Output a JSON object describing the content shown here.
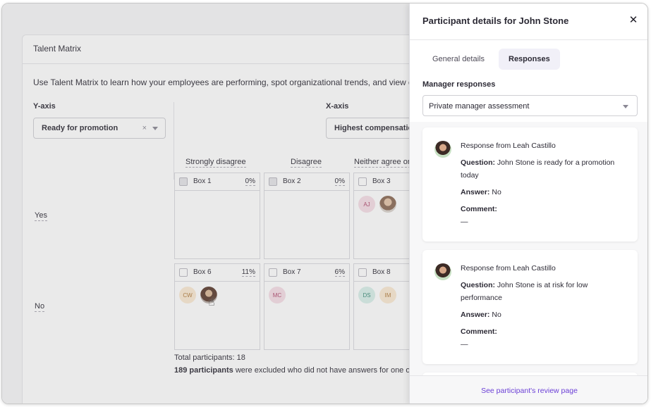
{
  "background": {
    "card_title": "Talent Matrix",
    "intro": "Use Talent Matrix to learn how your employees are performing, spot organizational trends, and view detailed",
    "y_axis": {
      "label": "Y-axis",
      "value": "Ready for promotion",
      "clear": "×"
    },
    "x_axis": {
      "label": "X-axis",
      "value": "Highest compensatio"
    },
    "columns": [
      "Strongly disagree",
      "Disagree",
      "Neither agree or"
    ],
    "rows": [
      "Yes",
      "No"
    ],
    "boxes": [
      {
        "name": "Box 1",
        "pct": "0%"
      },
      {
        "name": "Box 2",
        "pct": "0%"
      },
      {
        "name": "Box 3",
        "pct": "",
        "avatars": [
          "AJ"
        ]
      },
      {
        "name": "Box 6",
        "pct": "11%",
        "avatars": [
          "CW"
        ]
      },
      {
        "name": "Box 7",
        "pct": "6%",
        "avatars": [
          "MC"
        ]
      },
      {
        "name": "Box 8",
        "pct": "",
        "avatars": [
          "DS",
          "IM"
        ]
      }
    ],
    "totals_line1": "Total participants: 18",
    "totals_line2_bold": "189 participants",
    "totals_line2_rest": " were excluded who did not have answers for one or"
  },
  "drawer": {
    "title": "Participant details for John Stone",
    "close": "✕",
    "tabs": [
      {
        "label": "General details",
        "active": false
      },
      {
        "label": "Responses",
        "active": true
      }
    ],
    "manager_label": "Manager responses",
    "manager_select": "Private manager assessment",
    "responses": [
      {
        "from": "Response from Leah Castillo",
        "question_label": "Question:",
        "question": " John Stone is ready for a promotion today",
        "answer_label": "Answer:",
        "answer": " No",
        "comment_label": "Comment:",
        "comment": "—"
      },
      {
        "from": "Response from Leah Castillo",
        "question_label": "Question:",
        "question": " John Stone is at risk for low performance",
        "answer_label": "Answer:",
        "answer": " No",
        "comment_label": "Comment:",
        "comment": "—"
      }
    ],
    "footer_link": "See participant's review page"
  },
  "colors": {
    "accent": "#6b3fd6",
    "active_tab_bg": "#f1f0f8"
  }
}
